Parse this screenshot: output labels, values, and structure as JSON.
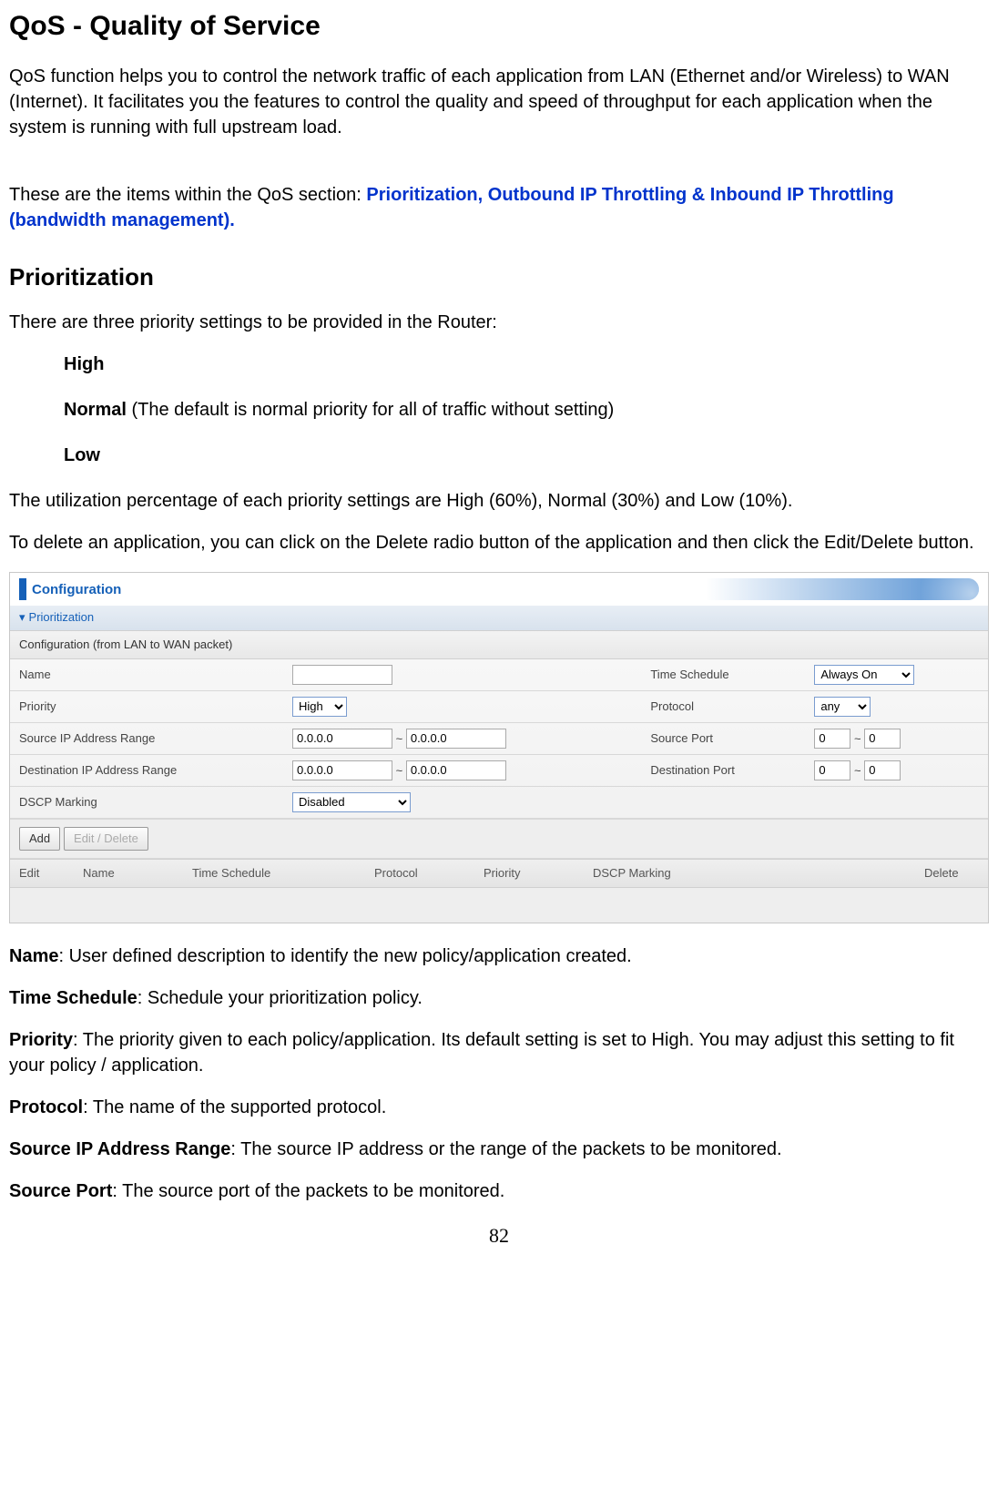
{
  "title": "QoS - Quality of Service",
  "intro": "QoS function helps you to control the network traffic of each application from LAN (Ethernet and/or Wireless) to WAN (Internet).  It facilitates you the features to control the quality and speed of throughput for each application when the system is running with full upstream load.",
  "items_lead": "These are the items within the QoS section: ",
  "items_blue": "Prioritization,  Outbound IP Throttling & Inbound IP Throttling (bandwidth management).",
  "h2": "Prioritization",
  "three_lead": "There are three priority settings to be provided in the Router:",
  "levels": {
    "high": "High",
    "normal_bold": "Normal",
    "normal_rest": " (The default is normal priority for all of traffic without setting)",
    "low": "Low"
  },
  "util": "The utilization percentage of each priority settings are High (60%), Normal (30%) and Low (10%).",
  "delete_note": "To delete an application, you can click on the Delete radio button of the application and then click the Edit/Delete button.",
  "panel": {
    "configuration": "Configuration",
    "sub": "Prioritization",
    "section": "Configuration (from LAN to WAN packet)",
    "rows": {
      "name": "Name",
      "time_schedule": "Time Schedule",
      "priority": "Priority",
      "protocol": "Protocol",
      "src_ip": "Source IP Address Range",
      "src_port": "Source Port",
      "dst_ip": "Destination IP Address Range",
      "dst_port": "Destination Port",
      "dscp": "DSCP Marking"
    },
    "values": {
      "time_schedule": "Always On",
      "priority": "High",
      "protocol": "any",
      "ip_zero": "0.0.0.0",
      "port_zero": "0",
      "dscp": "Disabled",
      "tilde": "~"
    },
    "buttons": {
      "add": "Add",
      "edit": "Edit / Delete"
    },
    "headers": {
      "edit": "Edit",
      "name": "Name",
      "time": "Time Schedule",
      "protocol": "Protocol",
      "priority": "Priority",
      "dscp": "DSCP Marking",
      "delete": "Delete"
    }
  },
  "defs": {
    "name_b": "Name",
    "name_t": ": User defined description to identify the new policy/application created.",
    "time_b": "Time Schedule",
    "time_t": ": Schedule your prioritization policy.",
    "prio_b": "Priority",
    "prio_t": ": The priority given to each policy/application. Its default setting is set to High. You may adjust this setting to fit your policy / application.",
    "proto_b": "Protocol",
    "proto_t": ": The name of the supported protocol.",
    "sip_b": "Source IP Address Range",
    "sip_t": ": The source IP address or the range of the packets to be monitored.",
    "sport_b": "Source Port",
    "sport_t": ": The source port of the packets to be monitored."
  },
  "page": "82"
}
